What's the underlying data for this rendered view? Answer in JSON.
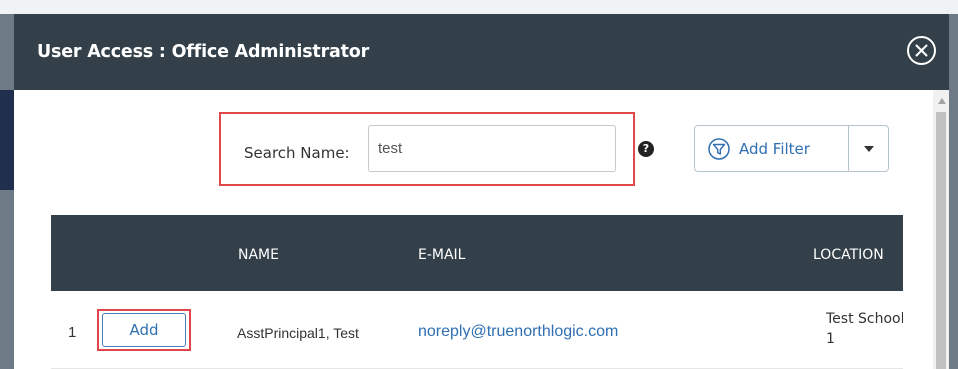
{
  "modal": {
    "title": "User Access : Office Administrator"
  },
  "search": {
    "label": "Search Name:",
    "value": "test",
    "help_icon": "question-circle-icon"
  },
  "filter": {
    "label": "Add Filter",
    "icon": "funnel-icon"
  },
  "table": {
    "columns": [
      "NAME",
      "E-MAIL",
      "LOCATION"
    ],
    "rows": [
      {
        "index": "1",
        "action_label": "Add",
        "name": "AsstPrincipal1, Test",
        "email": "noreply@truenorthlogic.com",
        "location_line1": "Test School",
        "location_line2": "1"
      }
    ]
  },
  "colors": {
    "header_bg": "#334049",
    "accent_blue": "#2f6fb2",
    "highlight_red": "#e0474c"
  }
}
